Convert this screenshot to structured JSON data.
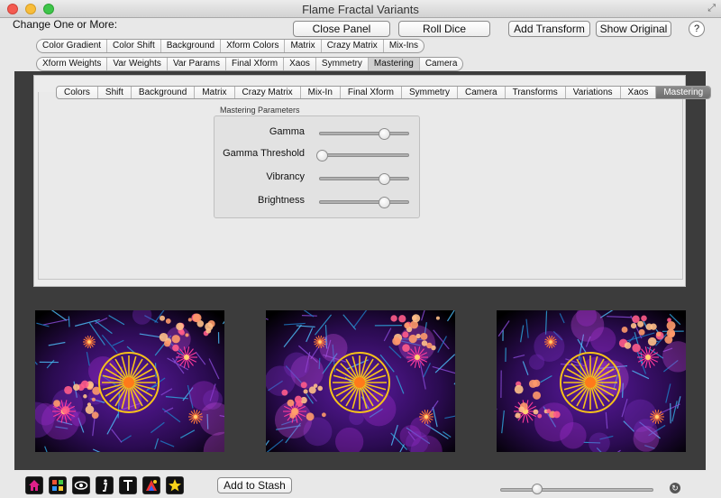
{
  "window": {
    "title": "Flame Fractal Variants"
  },
  "header": {
    "change_label": "Change One or More:",
    "close_panel": "Close Panel",
    "roll_dice": "Roll Dice",
    "add_transform": "Add Transform",
    "show_original": "Show Original",
    "help": "?"
  },
  "category_row1": [
    "Color Gradient",
    "Color Shift",
    "Background",
    "Xform Colors",
    "Matrix",
    "Crazy Matrix",
    "Mix-Ins"
  ],
  "category_row2": [
    "Xform Weights",
    "Var Weights",
    "Var Params",
    "Final Xform",
    "Xaos",
    "Symmetry",
    "Mastering",
    "Camera"
  ],
  "category_row2_active": "Mastering",
  "panel_tabs": [
    "Colors",
    "Shift",
    "Background",
    "Matrix",
    "Crazy Matrix",
    "Mix-In",
    "Final Xform",
    "Symmetry",
    "Camera",
    "Transforms",
    "Variations",
    "Xaos",
    "Mastering"
  ],
  "panel_tabs_active": "Mastering",
  "mastering": {
    "group_label": "Mastering Parameters",
    "params": [
      {
        "label": "Gamma",
        "value": 0.72
      },
      {
        "label": "Gamma Threshold",
        "value": 0.03
      },
      {
        "label": "Vibrancy",
        "value": 0.72
      },
      {
        "label": "Brightness",
        "value": 0.72
      }
    ]
  },
  "bottom": {
    "add_to_stash": "Add to Stash",
    "slider_value": 0.24,
    "icons": [
      "home-icon",
      "grid-icon",
      "eye-icon",
      "info-icon",
      "text-icon",
      "palette-icon",
      "star-icon"
    ]
  },
  "colors": {
    "accent_yellow": "#f7c21a",
    "accent_purple": "#7b2fbf",
    "accent_blue": "#2fa9e0"
  }
}
